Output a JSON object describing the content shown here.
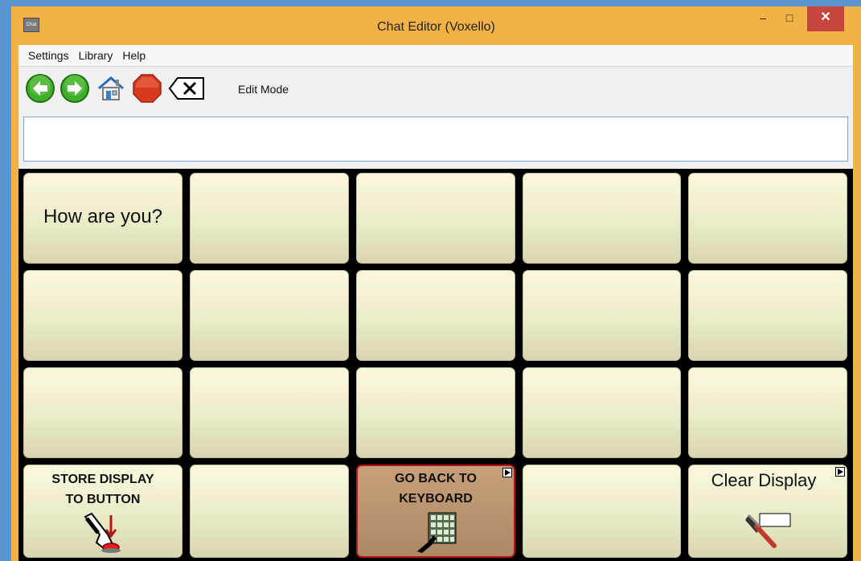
{
  "window": {
    "title": "Chat Editor (Voxello)",
    "app_icon_text": "Chat",
    "controls": {
      "minimize": "–",
      "maximize": "□",
      "close": "✕"
    }
  },
  "menu": [
    "Settings",
    "Library",
    "Help"
  ],
  "toolbar": {
    "icons": [
      "back-arrow-icon",
      "forward-arrow-icon",
      "home-icon",
      "stop-icon",
      "backspace-icon"
    ],
    "mode_label": "Edit Mode"
  },
  "display": {
    "value": ""
  },
  "grid": {
    "rows": 4,
    "cols": 5,
    "cells": [
      {
        "label": "How are you?"
      },
      {
        "label": ""
      },
      {
        "label": ""
      },
      {
        "label": ""
      },
      {
        "label": ""
      },
      {
        "label": ""
      },
      {
        "label": ""
      },
      {
        "label": ""
      },
      {
        "label": ""
      },
      {
        "label": ""
      },
      {
        "label": ""
      },
      {
        "label": ""
      },
      {
        "label": ""
      },
      {
        "label": ""
      },
      {
        "label": ""
      },
      {
        "label": "STORE DISPLAY TO BUTTON",
        "icon": "store-hand-icon"
      },
      {
        "label": ""
      },
      {
        "label": "GO BACK TO KEYBOARD",
        "icon": "keyboard-hand-icon",
        "style": "brown",
        "has_arrow": true
      },
      {
        "label": ""
      },
      {
        "label": "Clear Display",
        "icon": "squeegee-icon",
        "has_arrow": true
      }
    ]
  },
  "colors": {
    "titlebar": "#f3b246",
    "close_button": "#c7463c",
    "cell_light": "#f6f3d4",
    "cell_brown": "#b8926d",
    "grid_bg": "#000000"
  }
}
